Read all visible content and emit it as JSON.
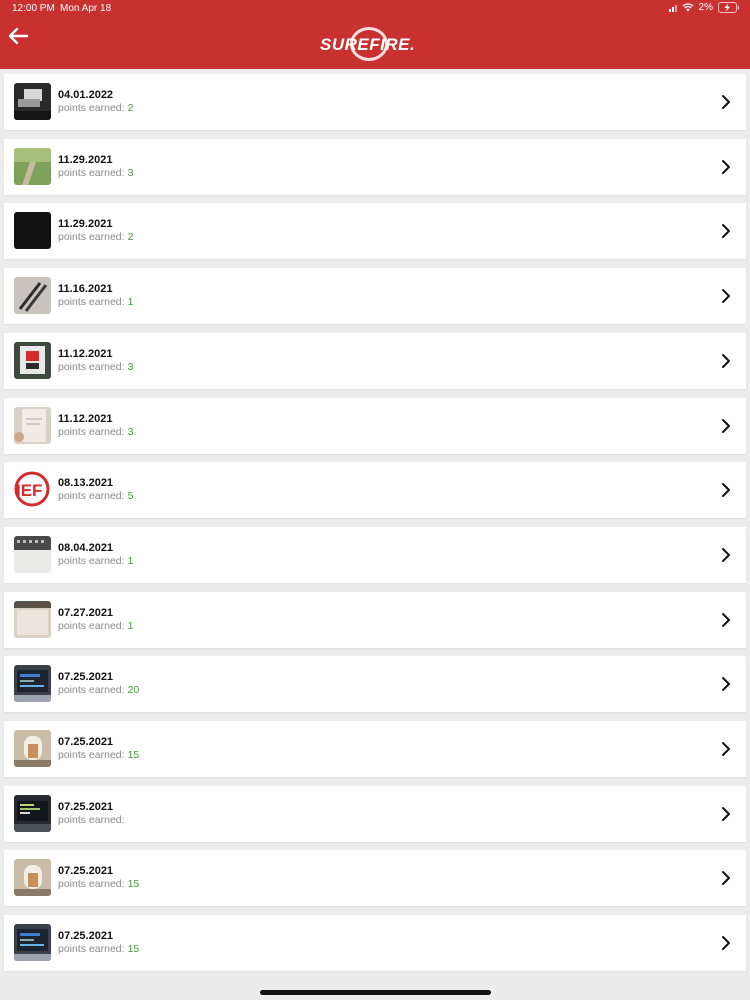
{
  "status_bar": {
    "time": "12:00 PM",
    "date": "Mon Apr 18",
    "battery": "2%"
  },
  "header": {
    "logo_text": "SUREFIRE."
  },
  "colors": {
    "brand_red": "#c8312f",
    "points_green": "#3e9d2f"
  },
  "entries": [
    {
      "date": "04.01.2022",
      "points_label": "points earned:",
      "points": "2",
      "thumb": "photo-dark"
    },
    {
      "date": "11.29.2021",
      "points_label": "points earned:",
      "points": "3",
      "thumb": "photo-grass"
    },
    {
      "date": "11.29.2021",
      "points_label": "points earned:",
      "points": "2",
      "thumb": "photo-black"
    },
    {
      "date": "11.16.2021",
      "points_label": "points earned:",
      "points": "1",
      "thumb": "photo-pens"
    },
    {
      "date": "11.12.2021",
      "points_label": "points earned:",
      "points": "3",
      "thumb": "photo-red-box"
    },
    {
      "date": "11.12.2021",
      "points_label": "points earned:",
      "points": "3",
      "thumb": "photo-receipt"
    },
    {
      "date": "08.13.2021",
      "points_label": "points earned:",
      "points": "5",
      "thumb": "photo-logo"
    },
    {
      "date": "08.04.2021",
      "points_label": "points earned:",
      "points": "1",
      "thumb": "photo-screen"
    },
    {
      "date": "07.27.2021",
      "points_label": "points earned:",
      "points": "1",
      "thumb": "photo-box"
    },
    {
      "date": "07.25.2021",
      "points_label": "points earned:",
      "points": "20",
      "thumb": "photo-monitor"
    },
    {
      "date": "07.25.2021",
      "points_label": "points earned:",
      "points": "15",
      "thumb": "photo-room"
    },
    {
      "date": "07.25.2021",
      "points_label": "points earned:",
      "points": "",
      "thumb": "photo-terminal"
    },
    {
      "date": "07.25.2021",
      "points_label": "points earned:",
      "points": "15",
      "thumb": "photo-room"
    },
    {
      "date": "07.25.2021",
      "points_label": "points earned:",
      "points": "15",
      "thumb": "photo-monitor"
    }
  ]
}
